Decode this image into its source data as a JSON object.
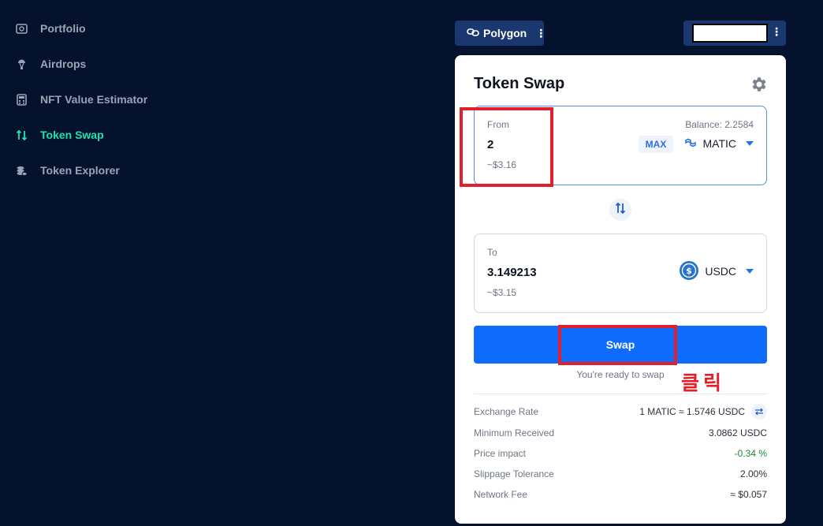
{
  "sidebar": {
    "items": [
      {
        "label": "Portfolio",
        "icon": "portfolio-icon",
        "active": false
      },
      {
        "label": "Airdrops",
        "icon": "airdrop-icon",
        "active": false
      },
      {
        "label": "NFT Value Estimator",
        "icon": "calculator-icon",
        "active": false
      },
      {
        "label": "Token Swap",
        "icon": "swap-arrows-icon",
        "active": true
      },
      {
        "label": "Token Explorer",
        "icon": "coins-icon",
        "active": false
      }
    ]
  },
  "header": {
    "network_label": "Polygon",
    "wallet_address": ""
  },
  "swap": {
    "title": "Token Swap",
    "from": {
      "label": "From",
      "amount": "2",
      "usd": "~$3.16",
      "balance": "Balance: 2.2584",
      "max_label": "MAX",
      "token": "MATIC"
    },
    "to": {
      "label": "To",
      "amount": "3.149213",
      "usd": "~$3.15",
      "token": "USDC"
    },
    "swap_button": "Swap",
    "ready_text": "You're ready to swap"
  },
  "details": [
    {
      "label": "Exchange Rate",
      "value": "1 MATIC ≈ 1.5746 USDC"
    },
    {
      "label": "Minimum Received",
      "value": "3.0862 USDC"
    },
    {
      "label": "Price impact",
      "value": "-0.34 %"
    },
    {
      "label": "Slippage Tolerance",
      "value": "2.00%"
    },
    {
      "label": "Network Fee",
      "value": "≈ $0.057"
    }
  ],
  "annotation": {
    "hint_text": "클릭"
  },
  "colors": {
    "background": "#04122e",
    "accent": "#0f6bfb",
    "active_nav": "#1ee3b1",
    "highlight": "#e0212b",
    "positive": "#1f8a3a"
  }
}
